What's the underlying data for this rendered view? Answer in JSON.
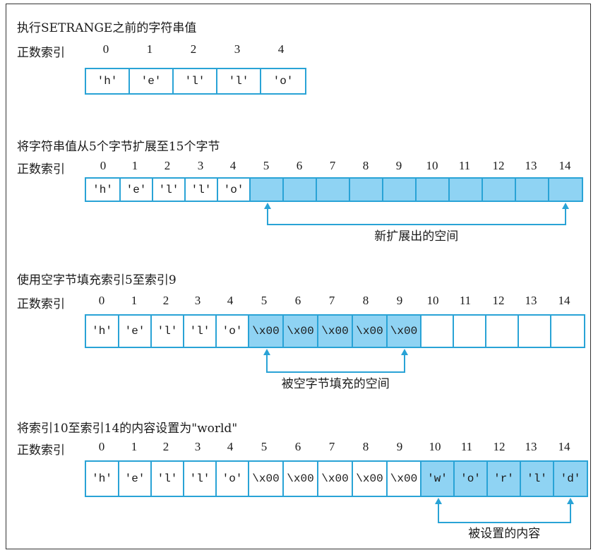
{
  "panels": [
    {
      "title": "执行SETRANGE之前的字符串值",
      "row_label": "正数索引",
      "indices": [
        "0",
        "1",
        "2",
        "3",
        "4"
      ],
      "cells": [
        {
          "text": "'h'",
          "fill": false
        },
        {
          "text": "'e'",
          "fill": false
        },
        {
          "text": "'l'",
          "fill": false
        },
        {
          "text": "'l'",
          "fill": false
        },
        {
          "text": "'o'",
          "fill": false
        }
      ],
      "caption": ""
    },
    {
      "title": "将字符串值从5个字节扩展至15个字节",
      "row_label": "正数索引",
      "indices": [
        "0",
        "1",
        "2",
        "3",
        "4",
        "5",
        "6",
        "7",
        "8",
        "9",
        "10",
        "11",
        "12",
        "13",
        "14"
      ],
      "cells": [
        {
          "text": "'h'",
          "fill": false
        },
        {
          "text": "'e'",
          "fill": false
        },
        {
          "text": "'l'",
          "fill": false
        },
        {
          "text": "'l'",
          "fill": false
        },
        {
          "text": "'o'",
          "fill": false
        },
        {
          "text": "",
          "fill": true
        },
        {
          "text": "",
          "fill": true
        },
        {
          "text": "",
          "fill": true
        },
        {
          "text": "",
          "fill": true
        },
        {
          "text": "",
          "fill": true
        },
        {
          "text": "",
          "fill": true
        },
        {
          "text": "",
          "fill": true
        },
        {
          "text": "",
          "fill": true
        },
        {
          "text": "",
          "fill": true
        },
        {
          "text": "",
          "fill": true
        }
      ],
      "caption": "新扩展出的空间"
    },
    {
      "title": "使用空字节填充索引5至索引9",
      "row_label": "正数索引",
      "indices": [
        "0",
        "1",
        "2",
        "3",
        "4",
        "5",
        "6",
        "7",
        "8",
        "9",
        "10",
        "11",
        "12",
        "13",
        "14"
      ],
      "cells": [
        {
          "text": "'h'",
          "fill": false
        },
        {
          "text": "'e'",
          "fill": false
        },
        {
          "text": "'l'",
          "fill": false
        },
        {
          "text": "'l'",
          "fill": false
        },
        {
          "text": "'o'",
          "fill": false
        },
        {
          "text": "\\x00",
          "fill": true
        },
        {
          "text": "\\x00",
          "fill": true
        },
        {
          "text": "\\x00",
          "fill": true
        },
        {
          "text": "\\x00",
          "fill": true
        },
        {
          "text": "\\x00",
          "fill": true
        },
        {
          "text": "",
          "fill": false
        },
        {
          "text": "",
          "fill": false
        },
        {
          "text": "",
          "fill": false
        },
        {
          "text": "",
          "fill": false
        },
        {
          "text": "",
          "fill": false
        }
      ],
      "caption": "被空字节填充的空间"
    },
    {
      "title": "将索引10至索引14的内容设置为\"world\"",
      "row_label": "正数索引",
      "indices": [
        "0",
        "1",
        "2",
        "3",
        "4",
        "5",
        "6",
        "7",
        "8",
        "9",
        "10",
        "11",
        "12",
        "13",
        "14"
      ],
      "cells": [
        {
          "text": "'h'",
          "fill": false
        },
        {
          "text": "'e'",
          "fill": false
        },
        {
          "text": "'l'",
          "fill": false
        },
        {
          "text": "'l'",
          "fill": false
        },
        {
          "text": "'o'",
          "fill": false
        },
        {
          "text": "\\x00",
          "fill": false
        },
        {
          "text": "\\x00",
          "fill": false
        },
        {
          "text": "\\x00",
          "fill": false
        },
        {
          "text": "\\x00",
          "fill": false
        },
        {
          "text": "\\x00",
          "fill": false
        },
        {
          "text": "'w'",
          "fill": true
        },
        {
          "text": "'o'",
          "fill": true
        },
        {
          "text": "'r'",
          "fill": true
        },
        {
          "text": "'l'",
          "fill": true
        },
        {
          "text": "'d'",
          "fill": true
        }
      ],
      "caption": "被设置的内容"
    }
  ],
  "colors": {
    "accent": "#29a3d6",
    "highlight_fill": "#8fd3f3",
    "border": "#333333"
  }
}
